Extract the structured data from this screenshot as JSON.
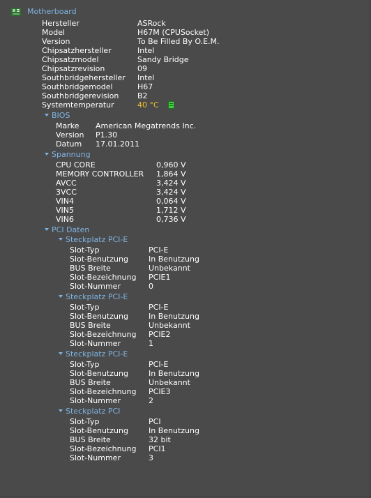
{
  "root": {
    "title": "Motherboard",
    "icon": "motherboard-icon"
  },
  "main_props": [
    {
      "label": "Hersteller",
      "value": "ASRock"
    },
    {
      "label": "Model",
      "value": "H67M (CPUSocket)"
    },
    {
      "label": "Version",
      "value": "To Be Filled By O.E.M."
    },
    {
      "label": "Chipsatzhersteller",
      "value": "Intel"
    },
    {
      "label": "Chipsatzmodel",
      "value": "Sandy Bridge"
    },
    {
      "label": "Chipsatzrevision",
      "value": "09"
    },
    {
      "label": "Southbridgehersteller",
      "value": "Intel"
    },
    {
      "label": "Southbridgemodel",
      "value": "H67"
    },
    {
      "label": "Southbridgerevision",
      "value": "B2"
    },
    {
      "label": "Systemtemperatur",
      "value": "40 °C"
    }
  ],
  "bios": {
    "title": "BIOS",
    "props": [
      {
        "label": "Marke",
        "value": "American Megatrends Inc."
      },
      {
        "label": "Version",
        "value": "P1.30"
      },
      {
        "label": "Datum",
        "value": "17.01.2011"
      }
    ]
  },
  "spannung": {
    "title": "Spannung",
    "props": [
      {
        "label": "CPU CORE",
        "value": "0,960 V"
      },
      {
        "label": "MEMORY CONTROLLER",
        "value": "1,864 V"
      },
      {
        "label": "AVCC",
        "value": "3,424 V"
      },
      {
        "label": "3VCC",
        "value": "3,424 V"
      },
      {
        "label": "VIN4",
        "value": "0,064 V"
      },
      {
        "label": "VIN5",
        "value": "1,712 V"
      },
      {
        "label": "VIN6",
        "value": "0,736 V"
      }
    ]
  },
  "pci": {
    "title": "PCI Daten",
    "slots": [
      {
        "title": "Steckplatz PCI-E",
        "props": [
          {
            "label": "Slot-Typ",
            "value": "PCI-E"
          },
          {
            "label": "Slot-Benutzung",
            "value": "In Benutzung"
          },
          {
            "label": "BUS Breite",
            "value": "Unbekannt"
          },
          {
            "label": "Slot-Bezeichnung",
            "value": "PCIE1"
          },
          {
            "label": "Slot-Nummer",
            "value": "0"
          }
        ]
      },
      {
        "title": "Steckplatz PCI-E",
        "props": [
          {
            "label": "Slot-Typ",
            "value": "PCI-E"
          },
          {
            "label": "Slot-Benutzung",
            "value": "In Benutzung"
          },
          {
            "label": "BUS Breite",
            "value": "Unbekannt"
          },
          {
            "label": "Slot-Bezeichnung",
            "value": "PCIE2"
          },
          {
            "label": "Slot-Nummer",
            "value": "1"
          }
        ]
      },
      {
        "title": "Steckplatz PCI-E",
        "props": [
          {
            "label": "Slot-Typ",
            "value": "PCI-E"
          },
          {
            "label": "Slot-Benutzung",
            "value": "In Benutzung"
          },
          {
            "label": "BUS Breite",
            "value": "Unbekannt"
          },
          {
            "label": "Slot-Bezeichnung",
            "value": "PCIE3"
          },
          {
            "label": "Slot-Nummer",
            "value": "2"
          }
        ]
      },
      {
        "title": "Steckplatz PCI",
        "props": [
          {
            "label": "Slot-Typ",
            "value": "PCI"
          },
          {
            "label": "Slot-Benutzung",
            "value": "In Benutzung"
          },
          {
            "label": "BUS Breite",
            "value": "32 bit"
          },
          {
            "label": "Slot-Bezeichnung",
            "value": "PCI1"
          },
          {
            "label": "Slot-Nummer",
            "value": "3"
          }
        ]
      }
    ]
  },
  "colors": {
    "background": "#4a4a4a",
    "section": "#7fb4e2",
    "text": "#ffffff",
    "temperature": "#f0c030",
    "temp_icon": "#44cc44"
  }
}
